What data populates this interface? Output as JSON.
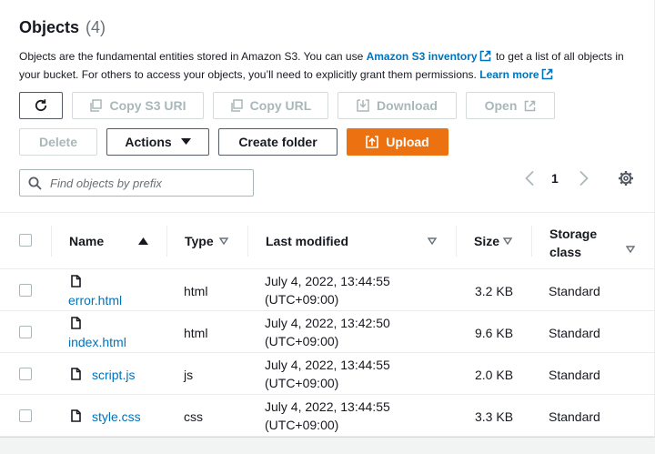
{
  "header": {
    "title": "Objects",
    "count": "(4)",
    "desc_part1": "Objects are the fundamental entities stored in Amazon S3. You can use ",
    "inventory_link": "Amazon S3 inventory",
    "desc_part2": " to get a list of all objects in your bucket. For others to access your objects, you’ll need to explicitly grant them permissions. ",
    "learn_more": "Learn more"
  },
  "toolbar": {
    "copy_uri": "Copy S3 URI",
    "copy_url": "Copy URL",
    "download": "Download",
    "open": "Open",
    "delete": "Delete",
    "actions": "Actions",
    "create_folder": "Create folder",
    "upload": "Upload"
  },
  "search": {
    "placeholder": "Find objects by prefix"
  },
  "pagination": {
    "page": "1"
  },
  "table": {
    "headers": {
      "name": "Name",
      "type": "Type",
      "last_modified": "Last modified",
      "size": "Size",
      "storage_class_line1": "Storage",
      "storage_class_line2": "class"
    },
    "rows": [
      {
        "name": "error.html",
        "type": "html",
        "modified_line1": "July 4, 2022, 13:44:55",
        "modified_line2": "(UTC+09:00)",
        "size": "3.2 KB",
        "storage": "Standard"
      },
      {
        "name": "index.html",
        "type": "html",
        "modified_line1": "July 4, 2022, 13:42:50",
        "modified_line2": "(UTC+09:00)",
        "size": "9.6 KB",
        "storage": "Standard"
      },
      {
        "name": "script.js",
        "type": "js",
        "modified_line1": "July 4, 2022, 13:44:55",
        "modified_line2": "(UTC+09:00)",
        "size": "2.0 KB",
        "storage": "Standard"
      },
      {
        "name": "style.css",
        "type": "css",
        "modified_line1": "July 4, 2022, 13:44:55",
        "modified_line2": "(UTC+09:00)",
        "size": "3.3 KB",
        "storage": "Standard"
      }
    ]
  },
  "colors": {
    "link": "#0073bb",
    "primary": "#ec7211",
    "text": "#16191f",
    "muted": "#687078"
  }
}
